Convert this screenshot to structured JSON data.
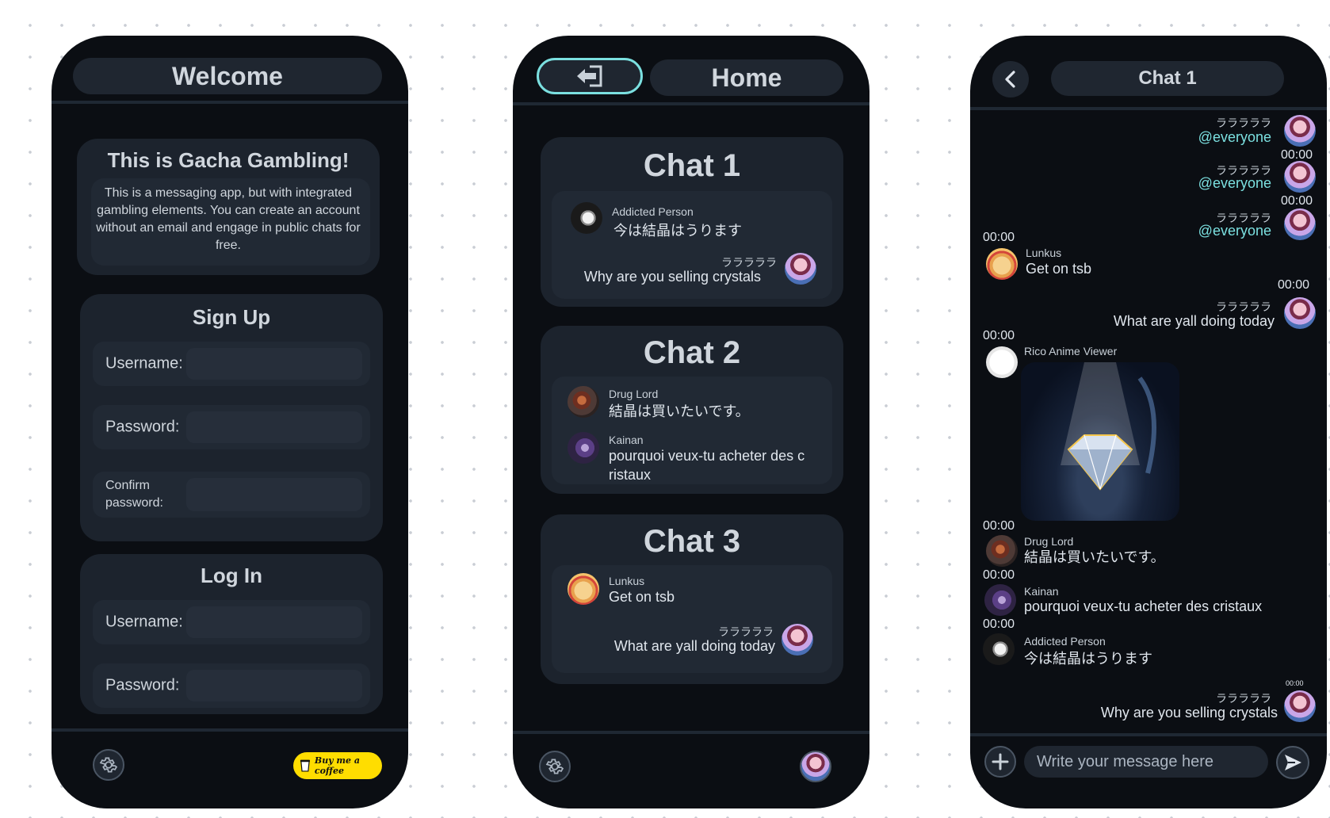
{
  "welcome": {
    "title": "Welcome",
    "intro_title": "This is Gacha Gambling!",
    "intro_text": "This is a messaging app, but with integrated gambling elements. You can create an account without an email and engage in public chats for free.",
    "signup": {
      "title": "Sign Up",
      "username_label": "Username:",
      "password_label": "Password:",
      "confirm_label": "Confirm password:"
    },
    "login": {
      "title": "Log In",
      "username_label": "Username:",
      "password_label": "Password:"
    },
    "coffee_label": "Buy me a coffee"
  },
  "home": {
    "title": "Home",
    "chats": [
      {
        "title": "Chat 1",
        "messages": [
          {
            "name": "Addicted Person",
            "text": "今は結晶はうります"
          },
          {
            "name": "ラララララ",
            "text": "Why are you selling crystals"
          }
        ]
      },
      {
        "title": "Chat 2",
        "messages": [
          {
            "name": "Drug Lord",
            "text": "結晶は買いたいです。"
          },
          {
            "name": "Kainan",
            "text_line1": "pourquoi veux-tu acheter des c",
            "text_line2": "ristaux"
          }
        ]
      },
      {
        "title": "Chat 3",
        "messages": [
          {
            "name": "Lunkus",
            "text": "Get on tsb"
          },
          {
            "name": "ラララララ",
            "text": "What are yall doing today"
          }
        ]
      }
    ]
  },
  "chat": {
    "title": "Chat 1",
    "messages": [
      {
        "name": "ラララララ",
        "text": "@everyone",
        "time": "00:00"
      },
      {
        "name": "ラララララ",
        "text": "@everyone",
        "time": "00:00"
      },
      {
        "name": "ラララララ",
        "text": "@everyone"
      },
      {
        "time_before": "00:00",
        "name": "Lunkus",
        "text": "Get on tsb"
      },
      {
        "time_before": "00:00",
        "name": "ラララララ",
        "text": "What are yall doing today"
      },
      {
        "time_before": "00:00",
        "name": "Rico Anime Viewer"
      },
      {
        "time_before": "00:00",
        "name": "Drug Lord",
        "text": "結晶は買いたいです。"
      },
      {
        "time_before": "00:00",
        "name": "Kainan",
        "text": "pourquoi veux-tu acheter des cristaux"
      },
      {
        "time_before": "00:00",
        "name": "Addicted Person",
        "text": "今は結晶はうります"
      },
      {
        "time_before": "00:00",
        "name": "ラララララ",
        "text": "Why are you selling crystals"
      }
    ],
    "input_placeholder": "Write your message here"
  },
  "colors": {
    "phone_bg": "#0b0e13",
    "card_bg": "#1c232d",
    "accent_cyan": "#7be0e0",
    "coffee_yellow": "#ffdd00"
  },
  "icons": [
    "gear-icon",
    "logout-icon",
    "back-chevron-icon",
    "plus-icon",
    "send-icon",
    "coffee-cup-icon"
  ]
}
